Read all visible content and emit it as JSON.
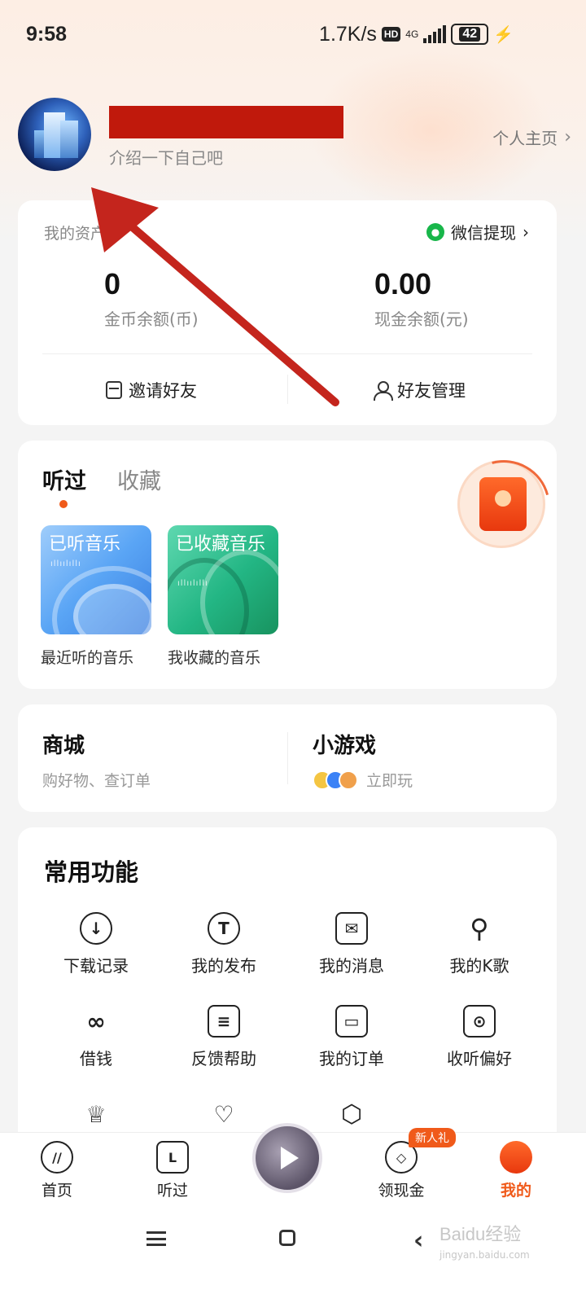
{
  "status_bar": {
    "time": "9:58",
    "net_speed": "1.7K/s",
    "hd": "HD",
    "network": "4G",
    "battery": "42"
  },
  "profile": {
    "bio": "介绍一下自己吧",
    "homepage_link": "个人主页"
  },
  "assets": {
    "title": "我的资产",
    "wechat_withdraw": "微信提现",
    "coin_value": "0",
    "coin_label": "金币余额(币)",
    "cash_value": "0.00",
    "cash_label": "现金余额(元)",
    "invite_label": "邀请好友",
    "friends_label": "好友管理"
  },
  "listen": {
    "tabs": [
      {
        "label": "听过"
      },
      {
        "label": "收藏"
      }
    ],
    "tiles": [
      {
        "title": "已听音乐",
        "caption": "最近听的音乐"
      },
      {
        "title": "已收藏音乐",
        "caption": "我收藏的音乐"
      }
    ]
  },
  "shop": {
    "mall_title": "商城",
    "mall_sub": "购好物、查订单",
    "game_title": "小游戏",
    "game_sub": "立即玩"
  },
  "features": {
    "title": "常用功能",
    "items": [
      {
        "label": "下载记录",
        "icon": "download-icon"
      },
      {
        "label": "我的发布",
        "icon": "publish-icon"
      },
      {
        "label": "我的消息",
        "icon": "message-icon"
      },
      {
        "label": "我的K歌",
        "icon": "karaoke-search-icon"
      },
      {
        "label": "借钱",
        "icon": "borrow-icon"
      },
      {
        "label": "反馈帮助",
        "icon": "feedback-icon"
      },
      {
        "label": "我的订单",
        "icon": "order-icon"
      },
      {
        "label": "收听偏好",
        "icon": "preference-icon"
      },
      {
        "label": "",
        "icon": "crown-icon"
      },
      {
        "label": "",
        "icon": "heart-wave-icon"
      },
      {
        "label": "",
        "icon": "settings-hex-icon"
      }
    ]
  },
  "tabbar": {
    "items": [
      {
        "label": "首页",
        "icon": "home-icon"
      },
      {
        "label": "听过",
        "icon": "history-icon"
      },
      {
        "label": "领现金",
        "icon": "cash-icon",
        "badge": "新人礼"
      },
      {
        "label": "我的",
        "icon": "me-icon"
      }
    ],
    "accent": "#f05a1a"
  },
  "watermark": {
    "text": "Baidu经验",
    "sub": "jingyan.baidu.com"
  }
}
